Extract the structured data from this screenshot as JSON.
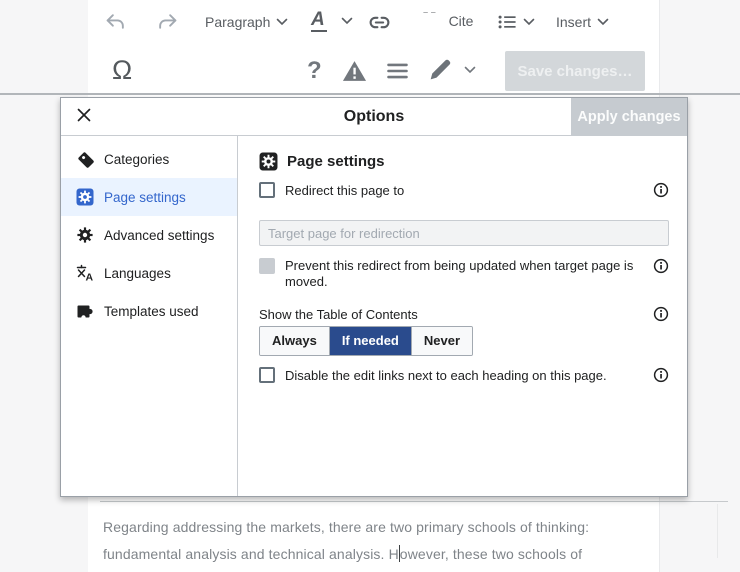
{
  "toolbar": {
    "paragraph_label": "Paragraph",
    "text_style_label": "A",
    "cite_label": "Cite",
    "insert_label": "Insert",
    "special_character_label": "Ω",
    "help_label": "?",
    "save_button_label": "Save changes…"
  },
  "dialog": {
    "title": "Options",
    "apply_button_label": "Apply changes",
    "sidebar": {
      "selected": "Page settings",
      "items": [
        {
          "label": "Categories",
          "icon": "tag-icon"
        },
        {
          "label": "Page settings",
          "icon": "page-settings-badge-icon"
        },
        {
          "label": "Advanced settings",
          "icon": "gear-icon"
        },
        {
          "label": "Languages",
          "icon": "language-icon"
        },
        {
          "label": "Templates used",
          "icon": "puzzle-icon"
        }
      ]
    },
    "panel": {
      "heading": "Page settings",
      "redirect": {
        "label": "Redirect this page to",
        "placeholder": "Target page for redirection",
        "checked": false
      },
      "prevent": {
        "label": "Prevent this redirect from being updated when target page is moved.",
        "disabled": true,
        "checked": false
      },
      "toc": {
        "label": "Show the Table of Contents",
        "options": [
          "Always",
          "If needed",
          "Never"
        ],
        "selected": "If needed"
      },
      "edit_links": {
        "label": "Disable the edit links next to each heading on this page.",
        "checked": false
      }
    }
  },
  "editor": {
    "line1": "Regarding addressing the markets, there are two primary schools of thinking:",
    "line2_before_caret": "fundamental analysis and technical analysis. H",
    "line2_after_caret": "owever, these two schools of"
  },
  "colors": {
    "accent_blue": "#3366cc",
    "selected_item_bg": "#eaf3ff",
    "toc_selected_bg": "#2a4b8d",
    "disabled_gray": "#c8ccd1",
    "border_gray": "#a2a9b1",
    "text": "#202122",
    "muted_text": "#72777d"
  }
}
